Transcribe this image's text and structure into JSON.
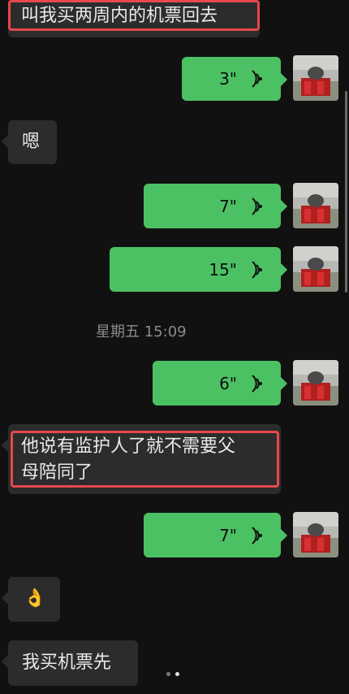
{
  "messages": {
    "m1": {
      "text": "叫我买两周内的机票回去"
    },
    "v1": {
      "duration": "3\""
    },
    "m2": {
      "text": "嗯"
    },
    "v2": {
      "duration": "7\""
    },
    "v3": {
      "duration": "15\""
    },
    "timestamp": "星期五 15:09",
    "v4": {
      "duration": "6\""
    },
    "m3": {
      "line1": "他说有监护人了就不需要父",
      "line2": "母陪同了"
    },
    "v5": {
      "duration": "7\""
    },
    "m4": {
      "text": "👌"
    },
    "m5": {
      "text": "我买机票先"
    }
  },
  "colors": {
    "background": "#111111",
    "incoming_bubble": "#2c2c2c",
    "outgoing_bubble": "#4cc164",
    "highlight": "#e5484d"
  },
  "icons": {
    "voice": "voice-wave-icon",
    "avatar": "avatar"
  }
}
